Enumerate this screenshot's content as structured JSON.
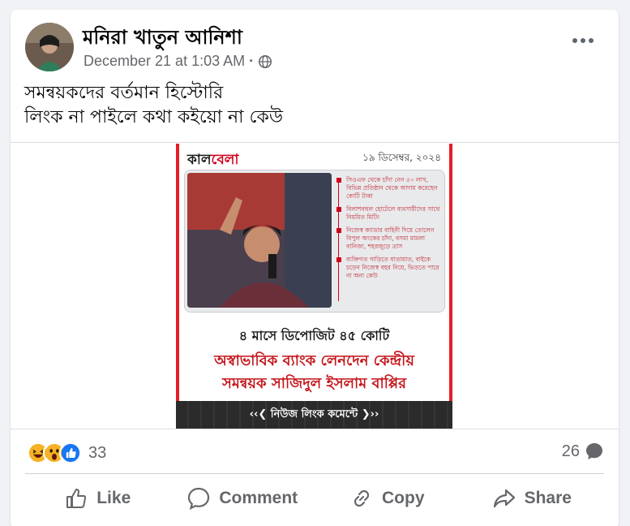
{
  "post": {
    "author": "মনিরা খাতুন আনিশা",
    "timestamp": "December 21 at 1:03 AM",
    "separator": "·",
    "privacy_icon": "globe-icon",
    "more_icon": "more-options-icon",
    "caption_lines": [
      "সমন্বয়কদের বর্তমান হিস্টোরি",
      "লিংক না পাইলে কথা কইয়ো না কেউ"
    ]
  },
  "media": {
    "logo_black": "কাল",
    "logo_red": "বেলা",
    "date": "১৯ ডিসেম্বর, ২০২৪",
    "bullets": [
      "সিওএফ থেকে চাঁদা নেন ৫০ লাখ, বিভিন্ন প্রতিষ্ঠান থেকে আদায় করেছেন কোটি টাকা",
      "বিলাশবহুল হোটেলে ব্যবসায়ীদের সাথে নিয়মিত মিটিং",
      "নিজেস্ব ক্যাডার বাহিনী দিয়ে তোলেন বিপুল অংকের চাঁদা, বসমা মামলা বানিজ্য, শহরজুড়ে ত্রাস",
      "ব্যক্তিগত গাড়িতে যাতায়াত, বাইকে চড়েন নিজেস্ব বহর নিয়ে, ভিড়তে পারে না অন্য কেউ"
    ],
    "headline1": "৪ মাসে ডিপোজিট ৪৫ কোটি",
    "headline2_line1": "অস্বাভাবিক ব্যাংক লেনদেন কেন্দ্রীয়",
    "headline2_line2": "সমন্বয়ক সাজিদুল ইসলাম বাপ্পির",
    "footer": "‹‹❮ নিউজ লিংক কমেন্টে ❯››"
  },
  "stats": {
    "reaction_icons": [
      "haha-icon",
      "wow-icon",
      "like-icon"
    ],
    "reaction_count": "33",
    "comment_count": "26",
    "comment_icon": "comment-bubble-icon"
  },
  "actions": {
    "like": "Like",
    "comment": "Comment",
    "copy": "Copy",
    "share": "Share"
  },
  "colors": {
    "brand_red": "#d0021b",
    "text_secondary": "#65676b",
    "like_blue": "#1877f2",
    "haha_yellow": "#f7b125"
  }
}
